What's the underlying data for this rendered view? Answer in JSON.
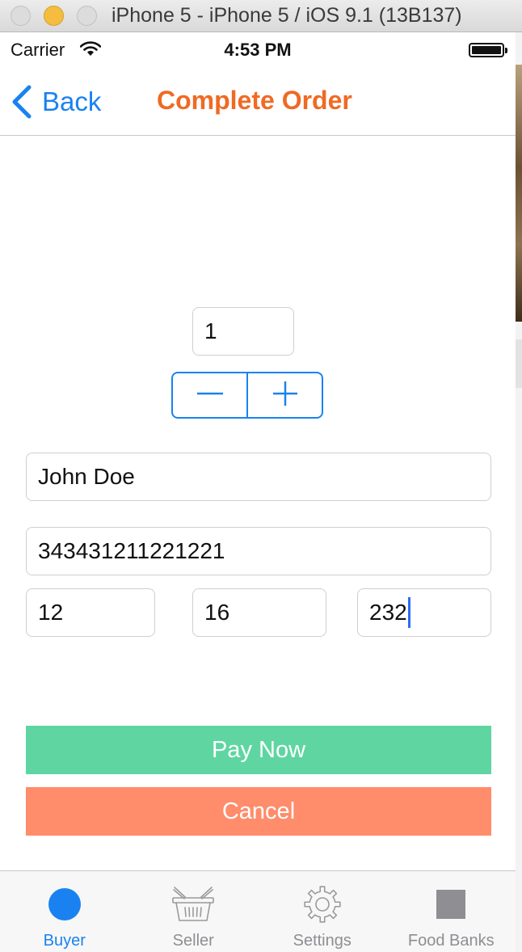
{
  "window": {
    "title": "iPhone 5 - iPhone 5 / iOS 9.1 (13B137)"
  },
  "status_bar": {
    "carrier": "Carrier",
    "time": "4:53 PM"
  },
  "nav": {
    "back_label": "Back",
    "title": "Complete Order"
  },
  "form": {
    "quantity": "1",
    "name": "John Doe",
    "card_number": "343431211221221",
    "exp_month": "12",
    "exp_year": "16",
    "cvv": "232"
  },
  "actions": {
    "pay_label": "Pay Now",
    "cancel_label": "Cancel"
  },
  "tabs": [
    {
      "label": "Buyer",
      "icon": "circle-icon",
      "active": true
    },
    {
      "label": "Seller",
      "icon": "basket-icon",
      "active": false
    },
    {
      "label": "Settings",
      "icon": "gear-icon",
      "active": false
    },
    {
      "label": "Food Banks",
      "icon": "square-icon",
      "active": false
    }
  ],
  "colors": {
    "accent": "#1a82f0",
    "title": "#ef6a24",
    "pay": "#5fd6a1",
    "cancel": "#ff8c6b"
  }
}
